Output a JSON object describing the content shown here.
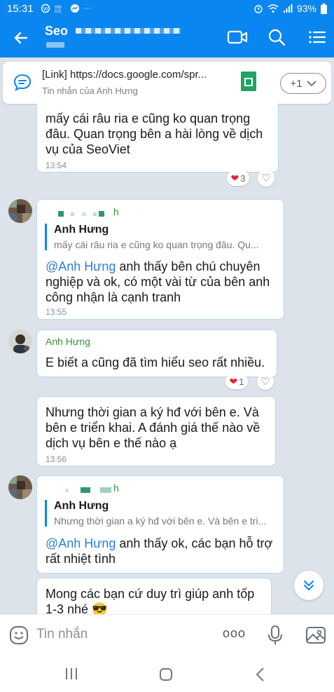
{
  "status_bar": {
    "time": "15:31",
    "battery": "93%",
    "icons": [
      "wifi-calling-icon",
      "mo-icon",
      "messenger-icon",
      "more-icon",
      "alarm-icon",
      "wifi-icon",
      "signal-icon",
      "battery-icon"
    ],
    "more": "···"
  },
  "header": {
    "title": "Seo",
    "icons": [
      "back-icon",
      "video-call-icon",
      "search-icon",
      "menu-icon"
    ]
  },
  "pinned": {
    "title": "[Link] https://docs.google.com/spr...",
    "subtitle": "Tin nhắn của Anh Hưng",
    "button_label": "+1"
  },
  "messages": [
    {
      "text": "mấy cái râu ria e cũng ko quan trọng đâu. Quan trọng bên a hài lòng về dịch vụ của SeoViet",
      "time": "13:54",
      "reaction_count": "3"
    },
    {
      "reply_name": "Anh Hưng",
      "reply_text": "mấy cái râu ria e cũng ko quan trọng đâu. Qu...",
      "mention": "@Anh Hưng",
      "text": " anh thấy bên chú chuyên nghiệp và ok, có một vài từ của bên anh công nhận là cạnh tranh",
      "time": "13:55",
      "sender_tail": "h"
    },
    {
      "sender": "Anh Hưng",
      "text": "E biết a cũng đã tìm hiểu seo rất nhiều.",
      "reaction_count": "1"
    },
    {
      "text": "Nhưng thời gian a ký hđ với bên e. Và bên e triển khai. A đánh giá thế nào về dịch vụ bên e thế nào ạ",
      "time": "13:56"
    },
    {
      "reply_name": "Anh Hưng",
      "reply_text": "Nhưng thời gian a ký hđ với bên e. Và bên e tri...",
      "mention": "@Anh Hưng",
      "text": " anh thấy ok, các bạn hỗ trợ rất nhiệt tình",
      "sender_tail": "h"
    },
    {
      "text": "Mong các bạn cứ duy trì giúp anh tốp 1-3 nhé 😎"
    }
  ],
  "input": {
    "placeholder": "Tin nhắn",
    "more": "ooo"
  },
  "colors": {
    "header": "#0a86f0",
    "background": "#dde3ea",
    "bubble_border": "#b9d8f6",
    "mention": "#2a7fd9",
    "sender": "#3b8d3b"
  }
}
